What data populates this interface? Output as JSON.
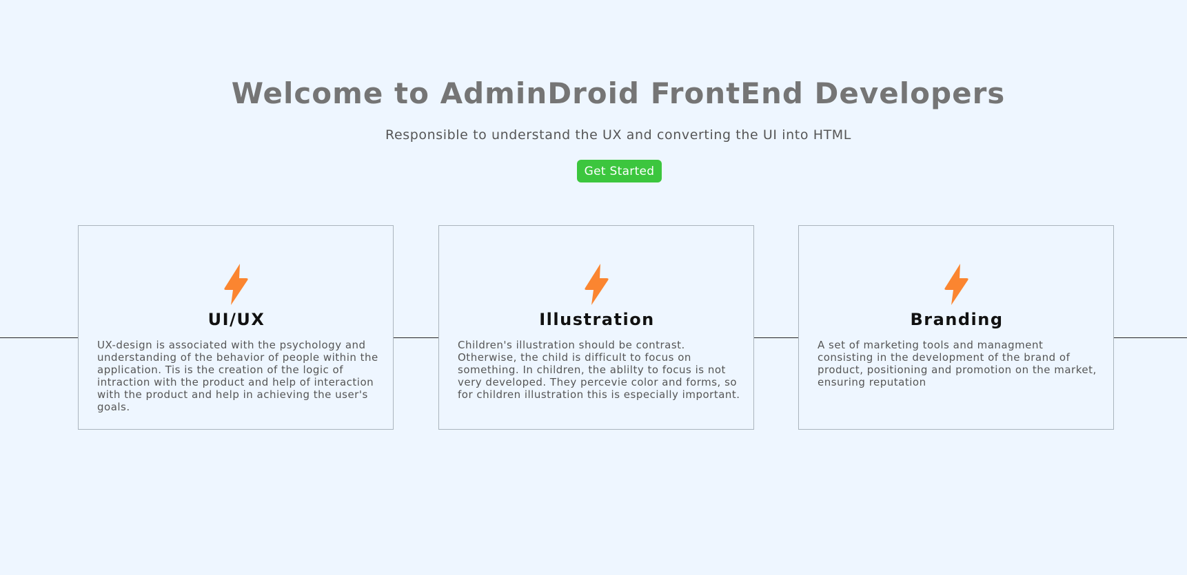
{
  "hero": {
    "title": "Welcome to AdminDroid FrontEnd Developers",
    "subtitle": "Responsible to understand the UX and converting the UI into HTML",
    "cta_label": "Get Started"
  },
  "colors": {
    "background": "#eef6ff",
    "title": "#757575",
    "cta": "#3cc63e",
    "icon": "#fb8530"
  },
  "cards": [
    {
      "icon": "lightning-bolt-icon",
      "title": "UI/UX",
      "text": "UX-design is associated with the psychology and understanding of the behavior of people within the application. Tis is the creation of the logic of intraction with the product and help of interaction with the product and help in achieving the user's goals."
    },
    {
      "icon": "lightning-bolt-icon",
      "title": "Illustration",
      "text": "Children's illustration should be contrast. Otherwise, the child is difficult to focus on something. In children, the ablilty to focus is not very developed. They percevie color and forms, so for children illustration this is especially important."
    },
    {
      "icon": "lightning-bolt-icon",
      "title": "Branding",
      "text": "A set of marketing tools and managment consisting in the development of the brand of product, positioning and promotion on the market, ensuring reputation"
    }
  ]
}
